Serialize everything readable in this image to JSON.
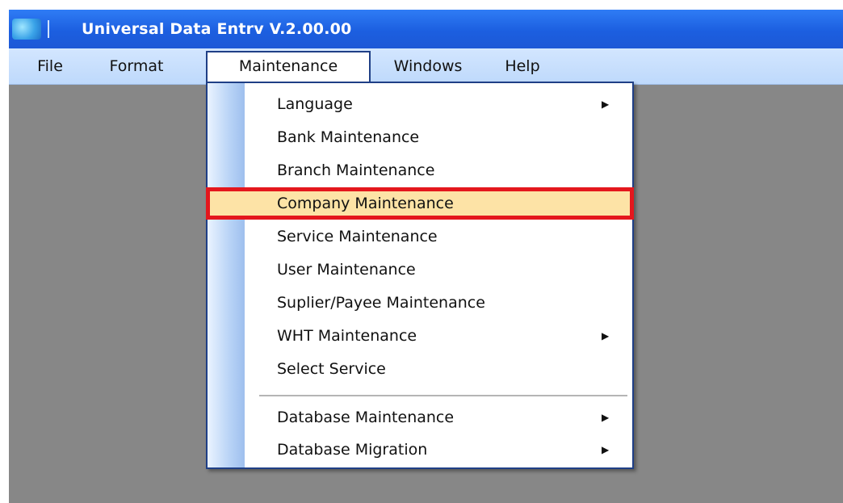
{
  "window": {
    "title": "Universal Data Entrv V.2.00.00"
  },
  "menubar": {
    "items": [
      {
        "label": "File"
      },
      {
        "label": "Format"
      },
      {
        "label": "Maintenance"
      },
      {
        "label": "Windows"
      },
      {
        "label": "Help"
      }
    ]
  },
  "dropdown": {
    "items": [
      {
        "label": "Language",
        "submenu": "▶"
      },
      {
        "label": "Bank Maintenance"
      },
      {
        "label": "Branch Maintenance"
      },
      {
        "label": "Company Maintenance",
        "highlighted": true
      },
      {
        "label": "Service Maintenance"
      },
      {
        "label": "User Maintenance"
      },
      {
        "label": "Suplier/Payee Maintenance"
      },
      {
        "label": "WHT Maintenance",
        "submenu": "▶"
      },
      {
        "label": "Select Service"
      },
      {
        "label": "Database Maintenance",
        "submenu": "▶"
      },
      {
        "label": "Database Migration",
        "submenu": "▶"
      }
    ]
  },
  "colors": {
    "titlebar": "#1d5fdc",
    "menubar": "#c6ddfb",
    "workspace": "#878787",
    "highlight_fill": "#fde3a6",
    "highlight_border": "#e4171d"
  },
  "icons": {
    "app": "app-globe-icon",
    "submenu_arrow": "submenu-arrow-icon"
  }
}
